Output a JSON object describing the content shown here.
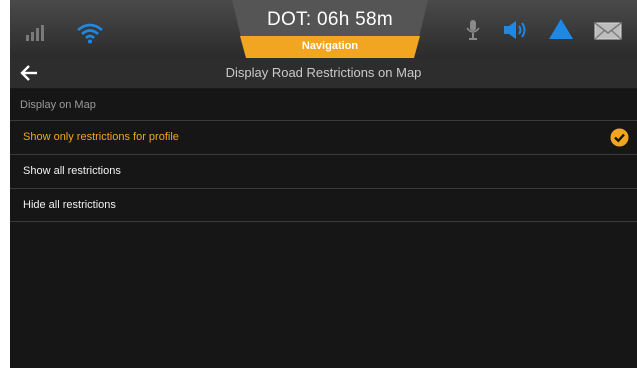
{
  "status_bar": {
    "dot_text": "DOT: 06h 58m",
    "mode_label": "Navigation",
    "icons": [
      "signal-bars-icon",
      "wifi-icon",
      "microphone-icon",
      "speaker-icon",
      "alert-triangle-icon",
      "mail-icon"
    ]
  },
  "header": {
    "title": "Display Road Restrictions on Map",
    "back_icon": "back-arrow-icon"
  },
  "section": {
    "label": "Display on Map",
    "options": [
      {
        "label": "Show only restrictions for profile",
        "selected": true
      },
      {
        "label": "Show all restrictions",
        "selected": false
      },
      {
        "label": "Hide all restrictions",
        "selected": false
      }
    ]
  },
  "colors": {
    "accent": "#F2A521",
    "blue_icon": "#1E88E5",
    "background": "#161616"
  }
}
